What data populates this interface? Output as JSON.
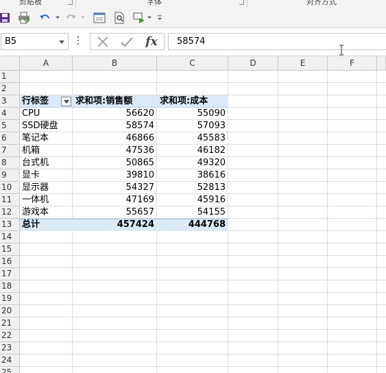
{
  "ribbon": {
    "groups": [
      "剪贴板",
      "字体",
      "对齐方式"
    ]
  },
  "quick_access": {
    "icons": [
      "save-icon",
      "print-preview-icon",
      "undo-icon",
      "redo-icon",
      "form-icon",
      "zoom-page-icon",
      "send-icon",
      "customize-icon"
    ]
  },
  "formula_bar": {
    "name_box": "B5",
    "value": "58574",
    "fx_label": "fx"
  },
  "columns": [
    "A",
    "B",
    "C",
    "D",
    "E",
    "F"
  ],
  "rows": [
    "1",
    "2",
    "3",
    "4",
    "5",
    "6",
    "7",
    "8",
    "9",
    "10",
    "11",
    "12",
    "13",
    "14",
    "15",
    "16",
    "17",
    "18",
    "19",
    "20",
    "21",
    "22",
    "23",
    "24",
    "25"
  ],
  "pivot": {
    "row_label_header": "行标签",
    "sales_header": "求和项:销售额",
    "cost_header": "求和项:成本",
    "items": [
      {
        "label": "CPU",
        "sales": "56620",
        "cost": "55090"
      },
      {
        "label": "SSD硬盘",
        "sales": "58574",
        "cost": "57093"
      },
      {
        "label": "笔记本",
        "sales": "46866",
        "cost": "45583"
      },
      {
        "label": "机箱",
        "sales": "47536",
        "cost": "46182"
      },
      {
        "label": "台式机",
        "sales": "50865",
        "cost": "49320"
      },
      {
        "label": "显卡",
        "sales": "39810",
        "cost": "38616"
      },
      {
        "label": "显示器",
        "sales": "54327",
        "cost": "52813"
      },
      {
        "label": "一体机",
        "sales": "47169",
        "cost": "45916"
      },
      {
        "label": "游戏本",
        "sales": "55657",
        "cost": "54155"
      }
    ],
    "total": {
      "label": "总计",
      "sales": "457424",
      "cost": "444768"
    }
  },
  "colors": {
    "pivot_header_fill": "#dce9f6",
    "save_icon": "#5b2d8e",
    "undo_icon": "#2a6fc4"
  }
}
